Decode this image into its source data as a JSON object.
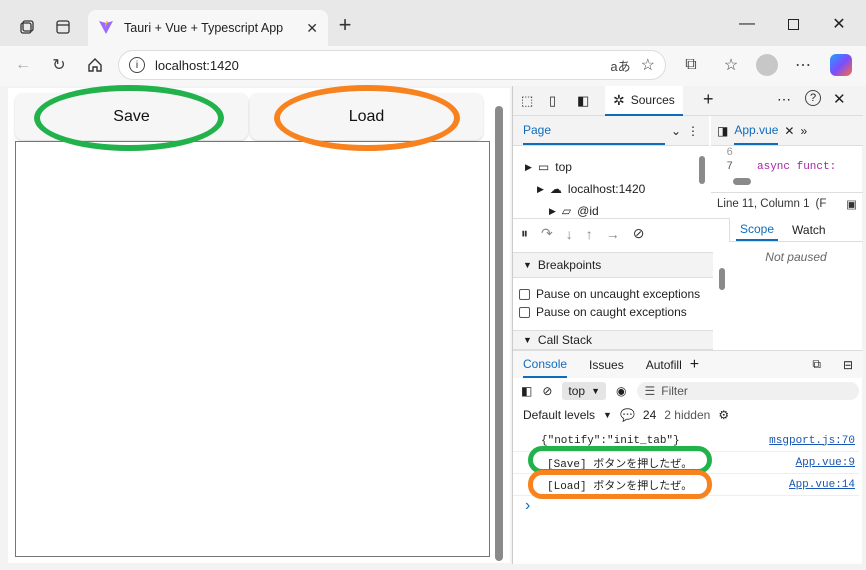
{
  "browser": {
    "tab_title": "Tauri + Vue + Typescript App",
    "url": "localhost:1420",
    "new_tab": "+"
  },
  "app": {
    "save_label": "Save",
    "load_label": "Load"
  },
  "devtools": {
    "sources_tab": "Sources",
    "page_tab": "Page",
    "file_tab": "App.vue",
    "tree": [
      "top",
      "localhost:1420",
      "@id"
    ],
    "code_lines": [
      {
        "num": "6",
        "text": ""
      },
      {
        "num": "7",
        "text": "async funct:"
      }
    ],
    "cursor_pos": "Line 11, Column 1",
    "cursor_extra": "(F",
    "breakpoints_title": "Breakpoints",
    "pause_uncaught": "Pause on uncaught exceptions",
    "pause_caught": "Pause on caught exceptions",
    "callstack_title": "Call Stack",
    "scope_tab": "Scope",
    "watch_tab": "Watch",
    "not_paused": "Not paused",
    "console_tabs": [
      "Console",
      "Issues",
      "Autofill"
    ],
    "context": "top",
    "filter_placeholder": "Filter",
    "levels": "Default levels",
    "message_count": "24",
    "hidden": "2 hidden",
    "logs": [
      {
        "text": "{\"notify\":\"init_tab\"}",
        "source": "msgport.js:70"
      },
      {
        "text": "[Save] ボタンを押したぜ。",
        "source": "App.vue:9"
      },
      {
        "text": "[Load] ボタンを押したぜ。",
        "source": "App.vue:14"
      }
    ],
    "prompt": "›"
  },
  "colors": {
    "accent": "#0f6cbd",
    "green_ring": "#21b24b",
    "orange_ring": "#f7821e"
  }
}
